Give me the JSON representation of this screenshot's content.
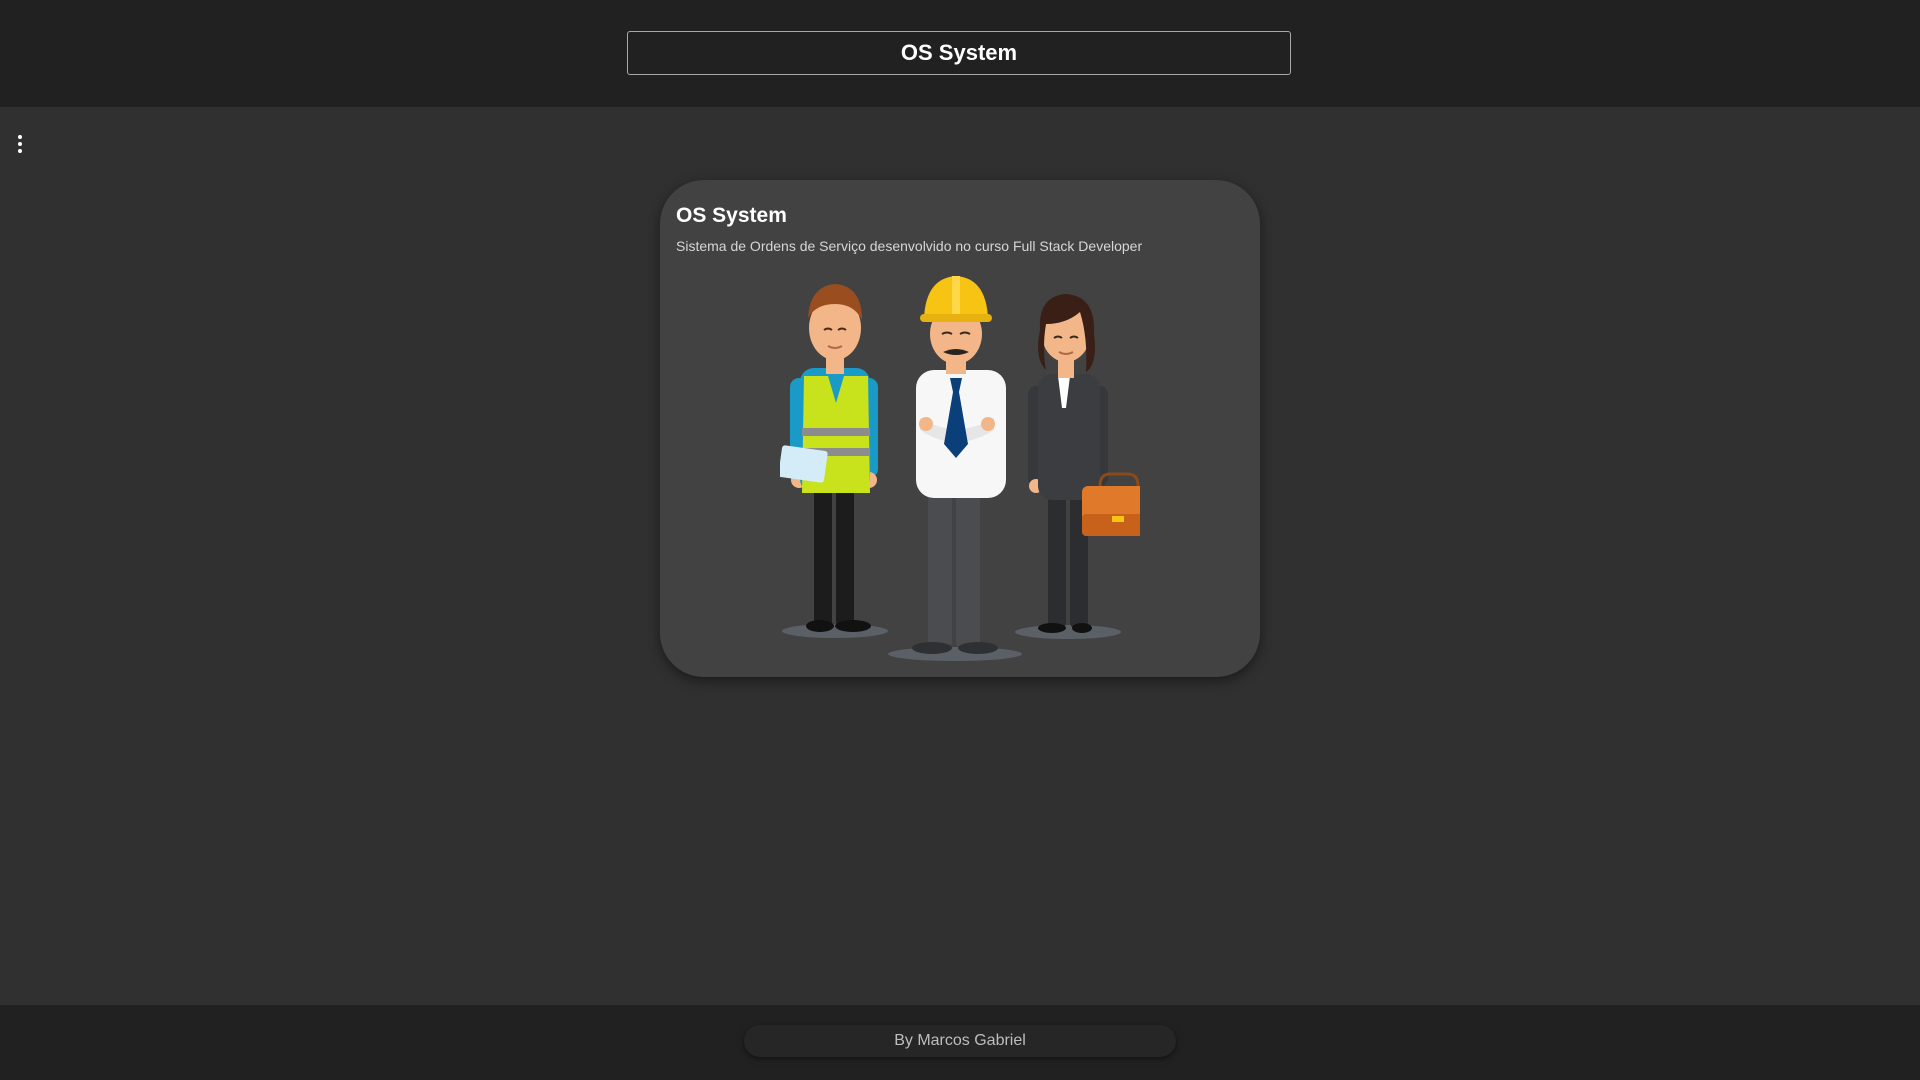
{
  "header": {
    "title": "OS System"
  },
  "menu": {
    "icon": "more-vert-icon"
  },
  "card": {
    "title": "OS System",
    "subtitle": "Sistema de Ordens de Serviço desenvolvido no curso Full Stack Developer",
    "illustration": "workers-illustration"
  },
  "footer": {
    "credit": "By Marcos Gabriel"
  },
  "colors": {
    "background": "#303030",
    "header": "#212121",
    "card": "#424242",
    "footer": "#212121"
  }
}
